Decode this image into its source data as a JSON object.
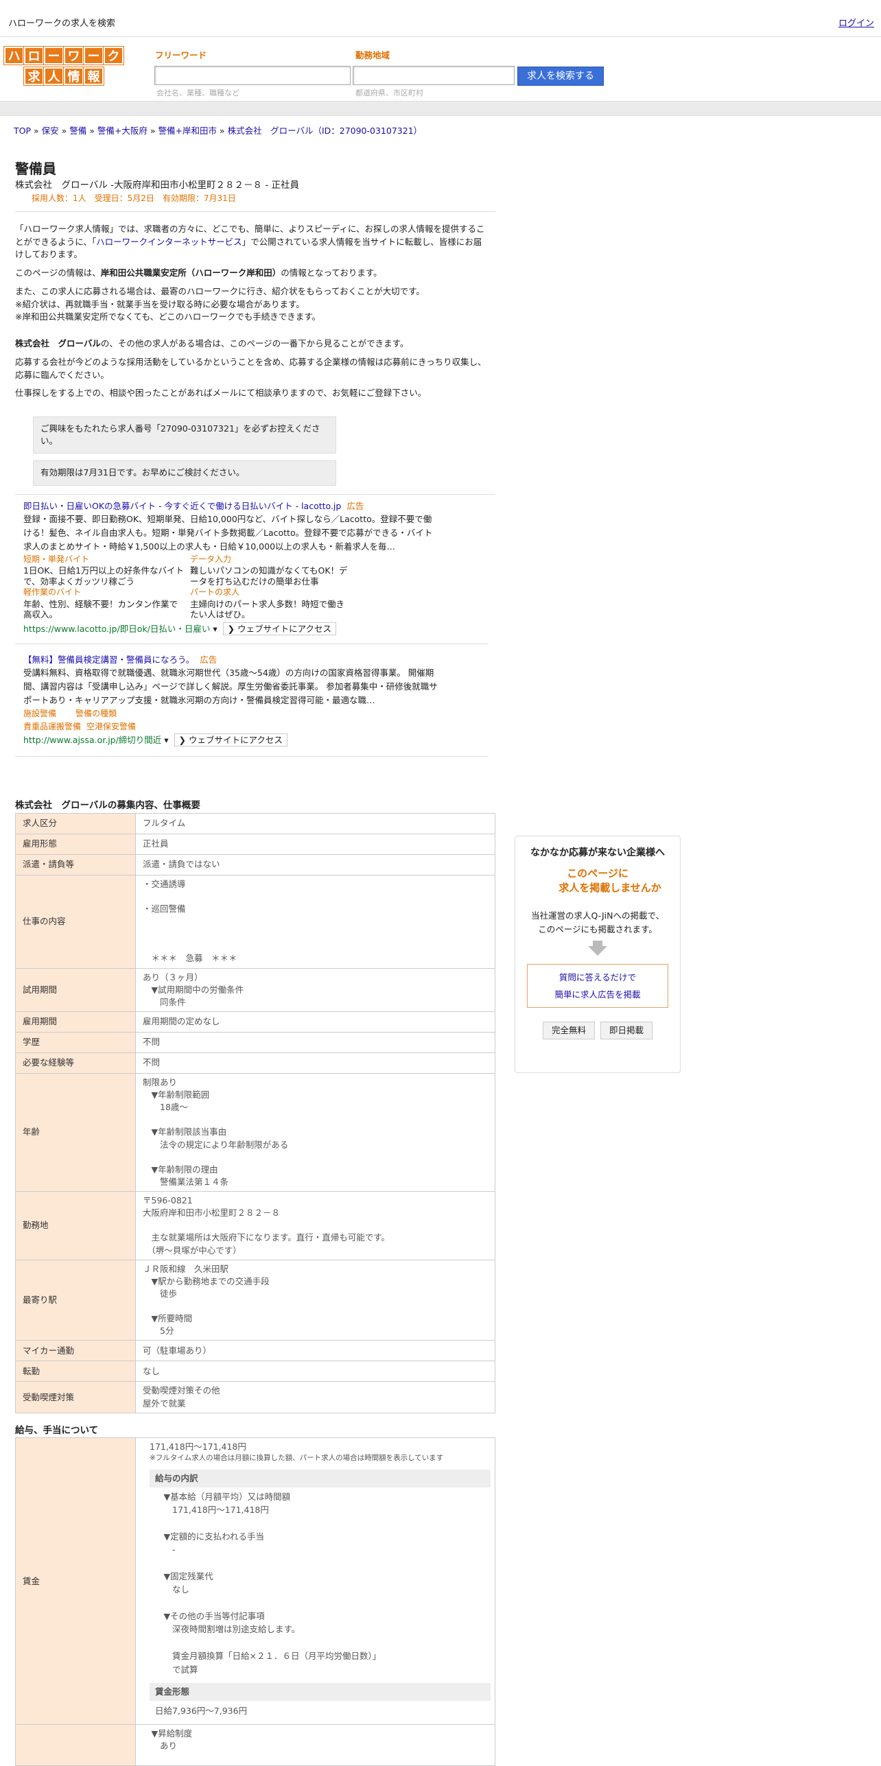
{
  "topbar": {
    "title": "ハローワークの求人を検索",
    "login": "ログイン"
  },
  "logo": {
    "row1": [
      "ハ",
      "ロ",
      "ー",
      "ワ",
      "ー",
      "ク"
    ],
    "row2": [
      "求",
      "人",
      "情",
      "報"
    ]
  },
  "search": {
    "free_label": "フリーワード",
    "area_label": "勤務地域",
    "free_hint": "会社名、業種、職種など",
    "area_hint": "都道府県、市区町村",
    "button": "求人を検索する"
  },
  "breadcrumb": [
    "TOP",
    "保安",
    "警備",
    "警備+大阪府",
    "警備+岸和田市",
    "株式会社　グローバル（ID：27090-03107321）"
  ],
  "job": {
    "title": "警備員",
    "subtitle": "株式会社　グローバル -大阪府岸和田市小松里町２８２－８ - 正社員",
    "meta": "採用人数：1人　受理日：5月2日　有効期限：7月31日"
  },
  "intro": {
    "p1a": "「ハローワーク求人情報」では、求職者の方々に、どこでも、簡単に、よりスピーディに、お探しの求人情報を提供することができるように、「",
    "p1link": "ハローワークインターネットサービス",
    "p1b": "」で公開されている求人情報を当サイトに転載し、皆様にお届けしております。",
    "p2a": "このページの情報は、",
    "p2b": "岸和田公共職業安定所（ハローワーク岸和田）",
    "p2c": "の情報となっております。",
    "p3": "また、この求人に応募される場合は、最寄のハローワークに行き、紹介状をもらっておくことが大切です。",
    "p4": "※紹介状は、再就職手当・就業手当を受け取る時に必要な場合があります。",
    "p5": "※岸和田公共職業安定所でなくても、どこのハローワークでも手続きできます。",
    "p6a": "株式会社　グローバル",
    "p6b": "の、その他の求人がある場合は、このページの一番下から見ることができます。",
    "p7": "応募する会社が今どのような採用活動をしているかということを含め、応募する企業様の情報は応募前にきっちり収集し、応募に臨んでください。",
    "p8": "仕事探しをする上での、相談や困ったことがあればメールにて相談承りますので、お気軽にご登録下さい。"
  },
  "notice": {
    "b1": "ご興味をもたれたら求人番号「27090-03107321」を必ずお控えください。",
    "b2": "有効期限は7月31日です。お早めにご検討ください。"
  },
  "ad1": {
    "title": "即日払い・日雇いOKの急募バイト - 今すぐ近くで働ける日払いバイト - lacotto.jp",
    "tag": "広告",
    "desc": "登録・面接不要、即日勤務OK、短期単発、日給10,000円など、バイト探しなら／Lacotto。登録不要で働ける！髪色、ネイル自由求人も。短期・単発バイト多数掲載／Lacotto。登録不要で応募ができる・バイト求人のまとめサイト・時給￥1,500以上の求人も・日給￥10,000以上の求人も・新着求人を毎…",
    "s1": "短期・単発バイト",
    "s1d": "1日OK、日給1万円以上の好条件なバイトで、効率よくガッツリ稼ごう",
    "s2": "データ入力",
    "s2d": "難しいパソコンの知識がなくてもOK！データを打ち込むだけの簡単お仕事",
    "s3": "軽作業のバイト",
    "s3d": "年齢、性別、経験不要！カンタン作業で高収入。",
    "s4": "パートの求人",
    "s4d": "主婦向けのパート求人多数！時短で働きたい人はぜひ。",
    "url": "https://www.lacotto.jp/即日ok/日払い・日雇い",
    "visit": "ウェブサイトにアクセス"
  },
  "ad2": {
    "title": "【無料】警備員検定講習・警備員になろう。",
    "tag": "広告",
    "desc": "受講料無料、資格取得で就職優遇、就職氷河期世代（35歳～54歳）の方向けの国家資格習得事業。 開催期間、講習内容は「受講申し込み」ページで詳しく解説。厚生労働省委託事業。 参加者募集中・研修後就職サポートあり・キャリアアップ支援・就職氷河期の方向け・警備員検定習得可能・最適な職…",
    "s1": "施設警備",
    "s2": "警備の種類",
    "s3": "貴重品運搬警備",
    "s4": "空港保安警備",
    "url": "http://www.ajssa.or.jp/締切り間近",
    "visit": "ウェブサイトにアクセス"
  },
  "table1": {
    "title": "株式会社　グローバルの募集内容、仕事概要",
    "rows": [
      {
        "k": "求人区分",
        "v": "フルタイム"
      },
      {
        "k": "雇用形態",
        "v": "正社員"
      },
      {
        "k": "派遣・請負等",
        "v": "派遣・請負ではない"
      },
      {
        "k": "仕事の内容",
        "v": "・交通誘導\n\n・巡回警備\n\n\n\n　＊＊＊　急募　＊＊＊"
      },
      {
        "k": "試用期間",
        "v": "あり（３ヶ月）\n　▼試用期間中の労働条件\n　　同条件"
      },
      {
        "k": "雇用期間",
        "v": "雇用期間の定めなし"
      },
      {
        "k": "学歴",
        "v": "不問"
      },
      {
        "k": "必要な経験等",
        "v": "不問"
      },
      {
        "k": "年齢",
        "v": "制限あり\n　▼年齢制限範囲\n　　18歳〜\n\n　▼年齢制限該当事由\n　　法令の規定により年齢制限がある\n\n　▼年齢制限の理由\n　　警備業法第１４条"
      },
      {
        "k": "勤務地",
        "v": "〒596-0821\n大阪府岸和田市小松里町２８２－８\n\n　主な就業場所は大阪府下になります。直行・直帰も可能です。\n　（堺～貝塚が中心です）"
      },
      {
        "k": "最寄り駅",
        "v": "ＪＲ阪和線　久米田駅\n　▼駅から勤務地までの交通手段\n　　徒歩\n\n　▼所要時間\n　　5分"
      },
      {
        "k": "マイカー通勤",
        "v": "可（駐車場あり）"
      },
      {
        "k": "転勤",
        "v": "なし"
      },
      {
        "k": "受動喫煙対策",
        "v": "受動喫煙対策その他\n屋外で就業"
      }
    ]
  },
  "table2": {
    "title": "給与、手当について",
    "key": "賃金",
    "top": "171,418円〜171,418円",
    "note": "※フルタイム求人の場合は月額に換算した額、パート求人の場合は時間額を表示しています",
    "sub1": "給与の内訳",
    "detail": "　▼基本給（月額平均）又は時間額\n　　171,418円〜171,418円\n\n　▼定額的に支払われる手当\n　　-\n\n　▼固定残業代\n　　なし\n\n　▼その他の手当等付記事項\n　　深夜時間割増は別途支給します。\n\n　　賃金月額換算「日給×２１．６日（月平均労働日数）」\n　　で試算",
    "sub2": "賃金形態",
    "wage": "日給7,936円〜7,936円",
    "next": "　▼昇給制度\n　　あり"
  },
  "side": {
    "t1": "なかなか応募が来ない企業様へ",
    "t2a": "このページに",
    "t2b": "求人を掲載しませんか",
    "t3a": "当社運営の求人Q-JiNへの掲載で、",
    "t3b": "このページにも掲載されます。",
    "l1": "質問に答えるだけで",
    "l2": "簡単に求人広告を掲載",
    "b1": "完全無料",
    "b2": "即日掲載"
  }
}
